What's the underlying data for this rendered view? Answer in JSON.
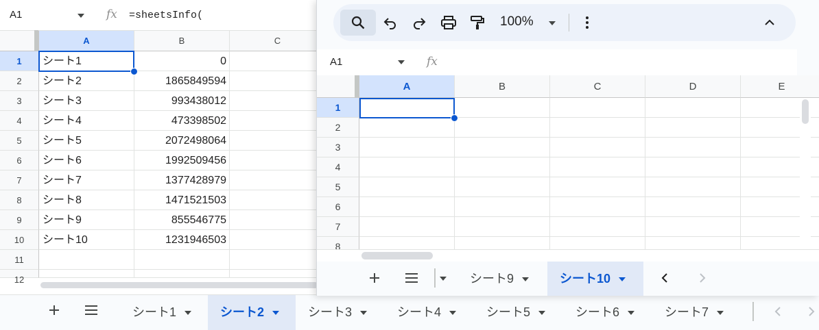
{
  "back": {
    "name_box": "A1",
    "formula": "=sheetsInfo(",
    "columns": [
      "A",
      "B",
      "C"
    ],
    "rows": [
      {
        "num": "1",
        "a": "シート1",
        "b": "0"
      },
      {
        "num": "2",
        "a": "シート2",
        "b": "1865849594"
      },
      {
        "num": "3",
        "a": "シート3",
        "b": "993438012"
      },
      {
        "num": "4",
        "a": "シート4",
        "b": "473398502"
      },
      {
        "num": "5",
        "a": "シート5",
        "b": "2072498064"
      },
      {
        "num": "6",
        "a": "シート6",
        "b": "1992509456"
      },
      {
        "num": "7",
        "a": "シート7",
        "b": "1377428979"
      },
      {
        "num": "8",
        "a": "シート8",
        "b": "1471521503"
      },
      {
        "num": "9",
        "a": "シート9",
        "b": "855546775"
      },
      {
        "num": "10",
        "a": "シート10",
        "b": "1231946503"
      },
      {
        "num": "11",
        "a": "",
        "b": ""
      },
      {
        "num": "12",
        "a": "",
        "b": ""
      }
    ],
    "tabs": [
      "シート1",
      "シート2",
      "シート3",
      "シート4",
      "シート5",
      "シート6",
      "シート7"
    ],
    "active_tab": "シート2"
  },
  "front": {
    "zoom": "100%",
    "name_box": "A1",
    "columns": [
      "A",
      "B",
      "C",
      "D",
      "E"
    ],
    "rows": [
      "1",
      "2",
      "3",
      "4",
      "5",
      "6",
      "7",
      "8"
    ],
    "tabs": [
      "シート9",
      "シート10"
    ],
    "active_tab": "シート10"
  },
  "icons": {
    "search": "search-icon",
    "undo": "undo-icon",
    "redo": "redo-icon",
    "print": "print-icon",
    "paint_format": "paint-format-icon",
    "more": "more-vert-icon",
    "collapse": "chevron-up-icon",
    "add_sheet": "plus-icon",
    "all_sheets": "menu-icon"
  },
  "colors": {
    "accent": "#0b57d0",
    "selection_fill": "#d3e3fd",
    "toolbar_bg": "#edf2fa"
  }
}
